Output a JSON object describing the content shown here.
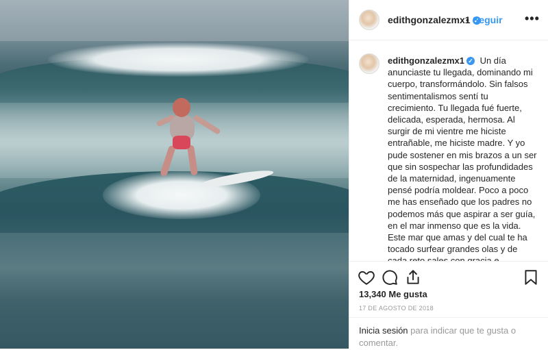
{
  "post": {
    "username": "edithgonzalezmx1",
    "verified_glyph": "✓",
    "dot": "•",
    "follow_label": "Seguir",
    "more_label": "•••",
    "caption": "Un día anunciaste tu llegada, dominando mi cuerpo, transformándolo. Sin falsos sentimentalismos sentí tu crecimiento. Tu llegada fué fuerte, delicada, esperada, hermosa. Al surgir de mi vientre me hiciste entrañable, me hiciste madre. Y yo pude sostener en mis brazos a un ser que sin sospechar las profundidades de la maternidad, ingenuamente pensé podría moldear. Poco a poco me has enseñado que los padres no podemos más que aspirar a ser guía, en el mar inmenso que es la vida. Este mar que amas y del cual te ha tocado surfear grandes olas y de cada reto sales con gracia e inteligencia. No amor, la vida no es fácil, mas es cabronamente hermosa. Te tienes que amar...",
    "likes": "13,340 Me gusta",
    "date": "17 DE AGOSTO DE 2018",
    "login_link": "Inicia sesión",
    "login_rest": " para indicar que te gusta o comentar."
  },
  "icons": {
    "like": "heart-icon",
    "comment": "comment-icon",
    "share": "share-icon",
    "save": "bookmark-icon",
    "more": "more-options-icon"
  },
  "colors": {
    "link_blue": "#3897f0",
    "text": "#262626",
    "muted": "#999999",
    "border": "#efefef"
  }
}
